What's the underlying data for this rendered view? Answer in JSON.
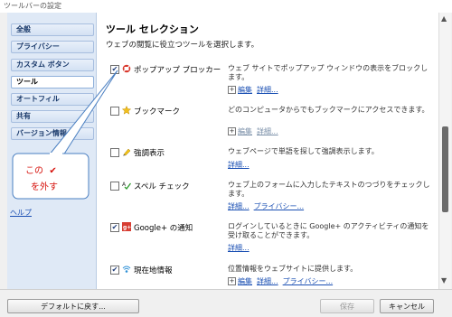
{
  "window": {
    "title": "ツールバーの設定"
  },
  "sidebar": {
    "items": [
      {
        "label": "全般"
      },
      {
        "label": "プライバシー"
      },
      {
        "label": "カスタム ボタン"
      },
      {
        "label": "ツール"
      },
      {
        "label": "オートフィル"
      },
      {
        "label": "共有"
      },
      {
        "label": "バージョン情報"
      }
    ],
    "help": "ヘルプ"
  },
  "main": {
    "title": "ツール セレクション",
    "description": "ウェブの閲覧に役立つツールを選択します。",
    "tools": [
      {
        "name": "ポップアップ ブロッカー",
        "checked": true,
        "icon": "popup-blocker-icon",
        "description": "ウェブ サイトでポップアップ ウィンドウの表示をブロックします。",
        "links": [
          "編集",
          "詳細..."
        ]
      },
      {
        "name": "ブックマーク",
        "checked": false,
        "icon": "bookmark-star-icon",
        "description": "どのコンピュータからでもブックマークにアクセスできます。",
        "links": [
          "編集",
          "詳細..."
        ]
      },
      {
        "name": "強調表示",
        "checked": false,
        "icon": "highlighter-icon",
        "description": "ウェブページで単語を探して強調表示します。",
        "links": [
          "詳細..."
        ]
      },
      {
        "name": "スペル チェック",
        "checked": false,
        "icon": "spellcheck-icon",
        "description": "ウェブ上のフォームに入力したテキストのつづりをチェックします。",
        "links": [
          "詳細...",
          "プライバシー..."
        ]
      },
      {
        "name": "Google+ の通知",
        "checked": true,
        "icon": "google-plus-icon",
        "description": "ログインしているときに Google+ のアクティビティの通知を受け取ることができます。",
        "links": [
          "詳細..."
        ]
      },
      {
        "name": "現在地情報",
        "checked": true,
        "icon": "location-icon",
        "description": "位置情報をウェブサイトに提供します。",
        "links": [
          "編集",
          "詳細...",
          "プライバシー..."
        ]
      }
    ]
  },
  "annotation": {
    "line1": "この",
    "check": "✔",
    "line2": "を外す"
  },
  "footer": {
    "reset_label": "デフォルトに戻す...",
    "save_label": "保存",
    "cancel_label": "キャンセル"
  },
  "colors": {
    "accent": "#1a4fb3",
    "callout": "#d6120c",
    "sidebar_bg": "#dfe9f6"
  }
}
